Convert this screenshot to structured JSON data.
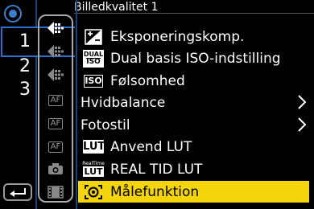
{
  "header": {
    "title": "Billedkvalitet 1"
  },
  "pages": {
    "numbers": [
      "1",
      "2",
      "3"
    ],
    "selected": "1"
  },
  "tabs": [
    {
      "icon": "photo-camera-icon",
      "active": true
    },
    {
      "icon": "photo-camera-icon",
      "active": false
    },
    {
      "icon": "photo-camera-icon",
      "active": false
    },
    {
      "icon": "af-icon",
      "text": "AF"
    },
    {
      "icon": "af-icon",
      "text": "AF"
    },
    {
      "icon": "af-icon",
      "text": "AF"
    },
    {
      "icon": "camera-icon"
    },
    {
      "icon": "film-icon"
    }
  ],
  "menu": {
    "items": [
      {
        "label": "Eksponeringskomp.",
        "icon": "exposure-compensation-icon"
      },
      {
        "label": "Dual basis ISO-indstilling",
        "icon": "dual-iso-icon",
        "icon_text_top": "DUAL",
        "icon_text_bottom": "ISO"
      },
      {
        "label": "Følsomhed",
        "icon": "iso-icon",
        "icon_text": "ISO"
      },
      {
        "label": "Hvidbalance",
        "has_submenu": true
      },
      {
        "label": "Fotostil",
        "has_submenu": true
      },
      {
        "label": "Anvend LUT",
        "icon": "lut-icon",
        "icon_text": "LUT"
      },
      {
        "label": "REAL TID LUT",
        "icon": "realtime-lut-icon",
        "icon_text_top": "RealTime",
        "icon_text": "LUT"
      },
      {
        "label": "Målefunktion",
        "icon": "metering-icon",
        "selected": true
      }
    ]
  },
  "colors": {
    "selection": "#f4d40a",
    "accent_blue": "#2a6fd0",
    "separator": "#1b3f78"
  }
}
